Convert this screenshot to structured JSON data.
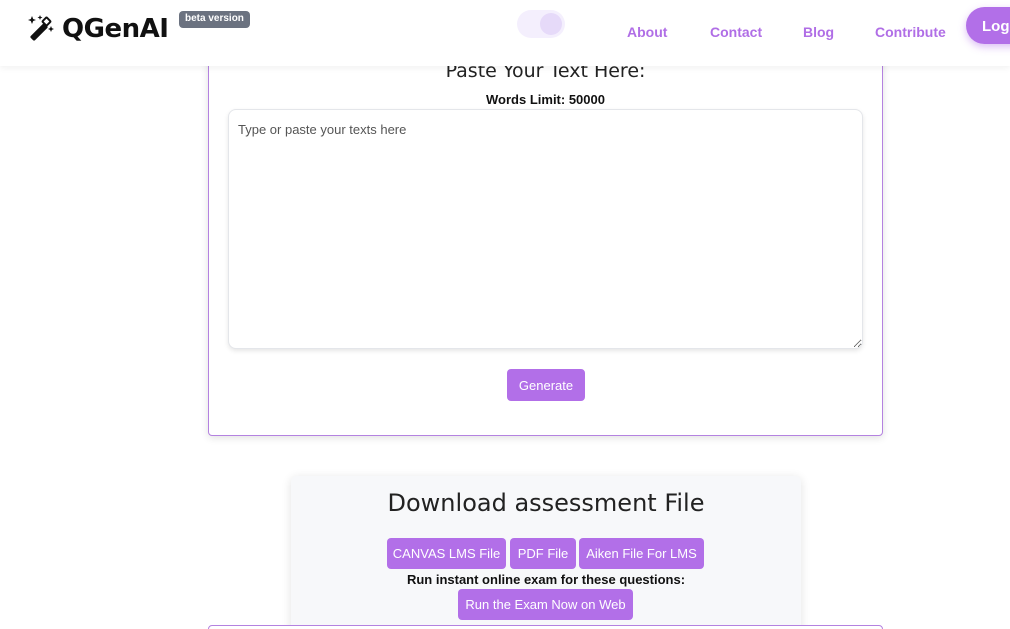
{
  "header": {
    "brand": {
      "name": "QGenAI",
      "icon": "magic-wand-icon",
      "badge": "beta version"
    },
    "nav": [
      {
        "label": "About"
      },
      {
        "label": "Contact"
      },
      {
        "label": "Blog"
      },
      {
        "label": "Contribute"
      }
    ],
    "login_label": "Log"
  },
  "input_section": {
    "title": "Paste Your Text Here:",
    "words_limit": "Words Limit: 50000",
    "textarea": {
      "placeholder": "Type or paste your texts here",
      "value": ""
    },
    "generate_label": "Generate"
  },
  "download_section": {
    "title": "Download assessment File",
    "buttons": [
      {
        "label": "CANVAS LMS File"
      },
      {
        "label": "PDF File"
      },
      {
        "label": "Aiken File For LMS"
      }
    ],
    "run_label": "Run instant online exam for these questions:",
    "run_button": "Run the Exam Now on Web"
  },
  "colors": {
    "accent": "#b26fe8",
    "nav_text": "#b06ee6",
    "badge_bg": "#6b7280",
    "card_border": "#b482e0"
  }
}
